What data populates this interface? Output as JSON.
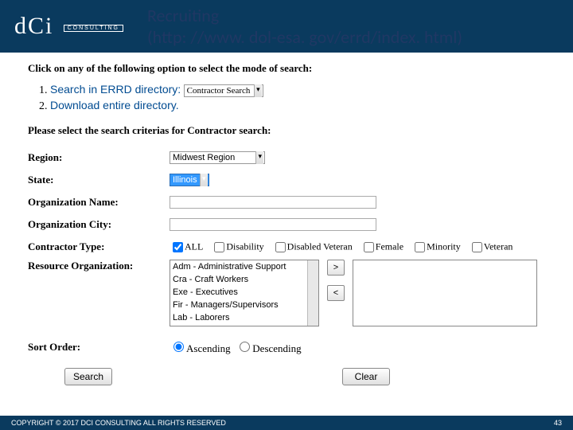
{
  "header": {
    "logo_main": "dCi",
    "logo_box": "CONSULTING",
    "title_line1": "Recruiting",
    "title_line2": "(http: //www. dol-esa. gov/errd/index. html)"
  },
  "body": {
    "mode_heading": "Click on any of the following option to select the mode of search:",
    "steps": {
      "s1_label": "Search in ERRD directory:",
      "s1_dropdown": "Contractor Search",
      "s2_label": "Download entire directory."
    },
    "criteria_heading": "Please select the search criterias for Contractor search:",
    "labels": {
      "region": "Region:",
      "state": "State:",
      "orgname": "Organization Name:",
      "orgcity": "Organization City:",
      "contractor_type": "Contractor Type:",
      "resource_org": "Resource Organization:",
      "sort_order": "Sort Order:"
    },
    "region_value": "Midwest Region",
    "state_value": "Illinois",
    "contractor_types": {
      "all": "ALL",
      "disability": "Disability",
      "disabled_veteran": "Disabled Veteran",
      "female": "Female",
      "minority": "Minority",
      "veteran": "Veteran"
    },
    "resource_options": [
      "Adm - Administrative Support",
      "Cra - Craft Workers",
      "Exe - Executives",
      "Fir - Managers/Supervisors",
      "Lab - Laborers"
    ],
    "sort": {
      "asc": "Ascending",
      "desc": "Descending"
    },
    "buttons": {
      "search": "Search",
      "clear": "Clear"
    }
  },
  "footer": {
    "copyright": "COPYRIGHT © 2017 DCI CONSULTING ALL RIGHTS RESERVED",
    "page": "43"
  }
}
